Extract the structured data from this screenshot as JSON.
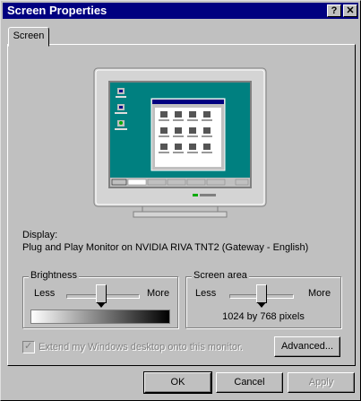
{
  "window": {
    "title": "Screen Properties",
    "help_btn": "?",
    "close_btn": "✕"
  },
  "tabs": [
    {
      "label": "Screen"
    }
  ],
  "display": {
    "label": "Display:",
    "monitor": "Plug and Play Monitor on NVIDIA RIVA TNT2 (Gateway - English)"
  },
  "brightness": {
    "title": "Brightness",
    "less": "Less",
    "more": "More",
    "value": 0.55
  },
  "screen_area": {
    "title": "Screen area",
    "less": "Less",
    "more": "More",
    "value": 0.55,
    "resolution": "1024 by 768 pixels"
  },
  "extend_checkbox": {
    "label": "Extend my Windows desktop onto this monitor.",
    "checked": true,
    "disabled": true
  },
  "buttons": {
    "advanced": "Advanced...",
    "ok": "OK",
    "cancel": "Cancel",
    "apply": "Apply"
  },
  "colors": {
    "title_bar": "#000080",
    "desktop": "#008080",
    "face": "#c0c0c0"
  }
}
